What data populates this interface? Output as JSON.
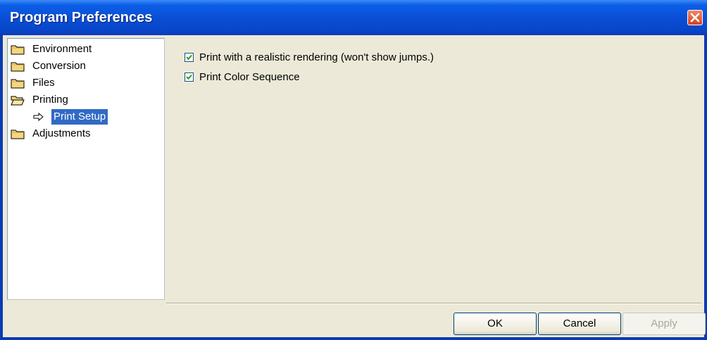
{
  "window": {
    "title": "Program Preferences"
  },
  "tree": {
    "items": [
      {
        "label": "Environment",
        "icon": "folder-closed-icon"
      },
      {
        "label": "Conversion",
        "icon": "folder-closed-icon"
      },
      {
        "label": "Files",
        "icon": "folder-closed-icon"
      },
      {
        "label": "Printing",
        "icon": "folder-open-icon"
      },
      {
        "label": "Print Setup",
        "icon": "arrow-right-icon",
        "selected": true
      },
      {
        "label": "Adjustments",
        "icon": "folder-closed-icon"
      }
    ]
  },
  "options": {
    "realistic_rendering": {
      "label": "Print with a realistic rendering (won't show jumps.)",
      "checked": true
    },
    "color_sequence": {
      "label": "Print Color Sequence",
      "checked": true
    }
  },
  "buttons": {
    "ok": "OK",
    "cancel": "Cancel",
    "apply": "Apply"
  },
  "colors": {
    "title_bar": "#0a4fd6",
    "dialog_bg": "#ece9d8",
    "selection": "#316ac5",
    "close_button": "#d9401c"
  }
}
